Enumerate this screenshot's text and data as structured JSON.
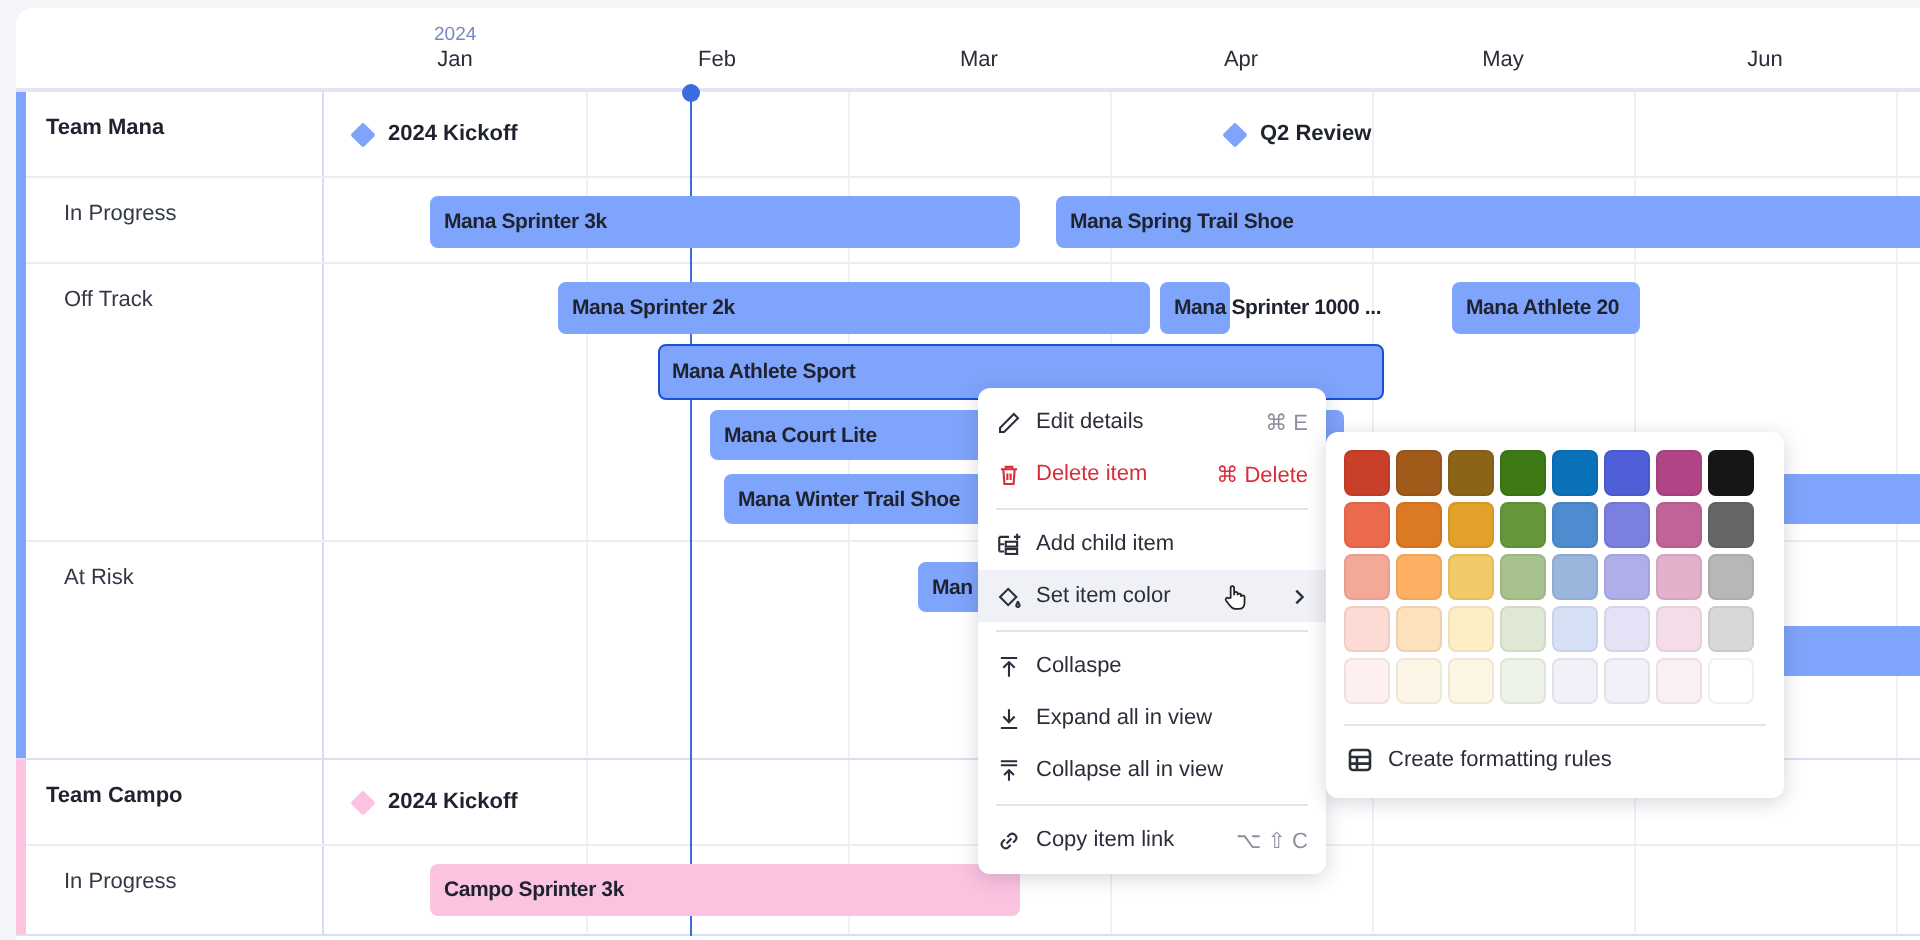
{
  "timeline": {
    "year": "2024",
    "months": [
      "Jan",
      "Feb",
      "Mar",
      "Apr",
      "May",
      "Jun"
    ]
  },
  "groups": [
    {
      "name": "Team Mana",
      "color": "#7fa4fb",
      "milestones": [
        {
          "label": "2024 Kickoff"
        },
        {
          "label": "Q2 Review"
        }
      ],
      "lanes": [
        {
          "name": "In Progress",
          "bars": [
            {
              "label": "Mana Sprinter 3k",
              "selected": false
            },
            {
              "label": "Mana Spring Trail Shoe",
              "selected": false
            }
          ]
        },
        {
          "name": "Off Track",
          "bars": [
            {
              "label": "Mana Sprinter 2k",
              "selected": false
            },
            {
              "label": "Mana Sprinter 1000 ...",
              "selected": false
            },
            {
              "label": "Mana Athlete 20",
              "selected": false
            },
            {
              "label": "Mana Athlete Sport",
              "selected": true
            },
            {
              "label": "Mana Court Lite",
              "selected": false
            },
            {
              "label": "Mana Winter Trail Shoe",
              "selected": false
            }
          ]
        },
        {
          "name": "At Risk",
          "bars": [
            {
              "label": "Man",
              "selected": false
            },
            {
              "selected": false
            }
          ]
        }
      ]
    },
    {
      "name": "Team Campo",
      "color": "#fbc3e0",
      "milestones": [
        {
          "label": "2024 Kickoff"
        }
      ],
      "lanes": [
        {
          "name": "In Progress",
          "bars": [
            {
              "label": "Campo Sprinter 3k",
              "selected": false
            }
          ]
        }
      ]
    }
  ],
  "context_menu": {
    "sections": [
      [
        {
          "label": "Edit details",
          "shortcut": "⌘ E",
          "kind": "action",
          "highlighted": false
        },
        {
          "label": "Delete item",
          "shortcut": "⌘ Delete",
          "kind": "danger",
          "highlighted": false
        }
      ],
      [
        {
          "label": "Add child item",
          "kind": "action",
          "highlighted": false
        },
        {
          "label": "Set item color",
          "kind": "submenu",
          "highlighted": true
        }
      ],
      [
        {
          "label": "Collaspe",
          "kind": "action",
          "highlighted": false
        },
        {
          "label": "Expand all in view",
          "kind": "action",
          "highlighted": false
        },
        {
          "label": "Collapse all in view",
          "kind": "action",
          "highlighted": false
        }
      ],
      [
        {
          "label": "Copy item link",
          "shortcut": "⌥ ⇧ C",
          "kind": "action",
          "highlighted": false
        }
      ]
    ]
  },
  "color_submenu": {
    "swatches": [
      [
        {
          "color": "#c8402a"
        },
        {
          "color": "#a05a1a"
        },
        {
          "color": "#8c6418"
        },
        {
          "color": "#3d7a16"
        },
        {
          "color": "#0a72b8"
        },
        {
          "color": "#4f5fd8"
        },
        {
          "color": "#b04485"
        },
        {
          "color": "#161616"
        }
      ],
      [
        {
          "color": "#eb6a4e"
        },
        {
          "color": "#db7a22"
        },
        {
          "color": "#e2a12a"
        },
        {
          "color": "#64983a"
        },
        {
          "color": "#4f8ccf"
        },
        {
          "color": "#7b7fe0"
        },
        {
          "color": "#c06497"
        },
        {
          "color": "#666666"
        }
      ],
      [
        {
          "color": "#f4a898"
        },
        {
          "color": "#fdb062"
        },
        {
          "color": "#f2c967"
        },
        {
          "color": "#a7c28c"
        },
        {
          "color": "#9ab6dc"
        },
        {
          "color": "#b0aeea"
        },
        {
          "color": "#e2b0cb"
        },
        {
          "color": "#b7b7b7"
        }
      ],
      [
        {
          "color": "#fddad3"
        },
        {
          "color": "#fde0bc"
        },
        {
          "color": "#fdeec4"
        },
        {
          "color": "#dfe8d4"
        },
        {
          "color": "#d6e1f6"
        },
        {
          "color": "#e4e2f6"
        },
        {
          "color": "#f4dde9"
        },
        {
          "color": "#d8d8d8"
        }
      ],
      [
        {
          "color": "#fdf0ee"
        },
        {
          "color": "#fdf6e6"
        },
        {
          "color": "#fdf6e4"
        },
        {
          "color": "#eef3ea"
        },
        {
          "color": "#f1f2f9"
        },
        {
          "color": "#f1f2f9"
        },
        {
          "color": "#f9eff4"
        },
        {
          "color": "#ffffff"
        }
      ]
    ],
    "footer": "Create formatting rules"
  }
}
